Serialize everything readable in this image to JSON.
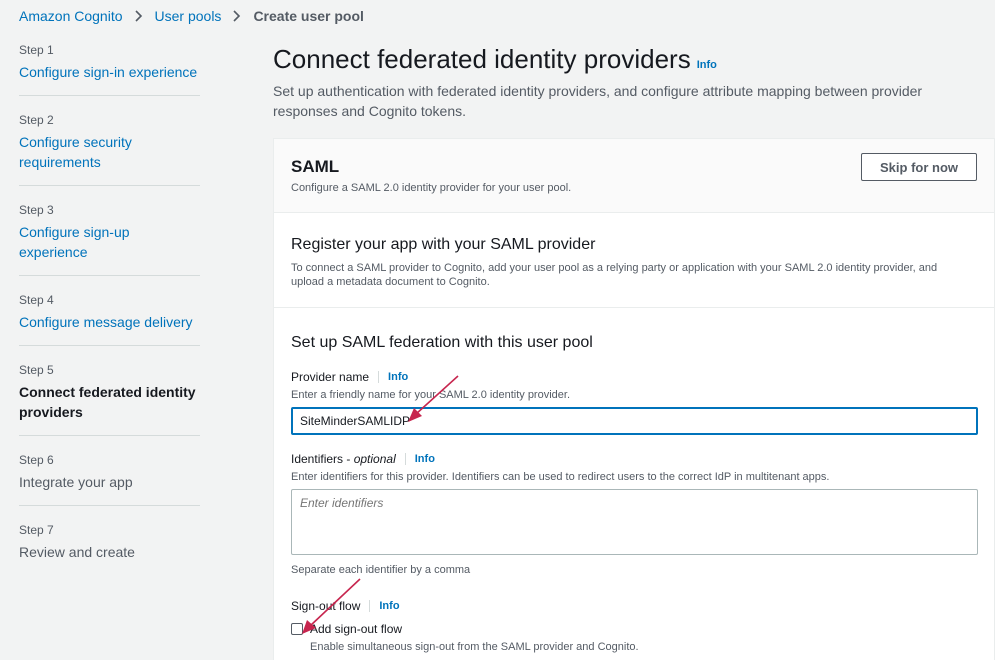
{
  "breadcrumb": {
    "item1": "Amazon Cognito",
    "item2": "User pools",
    "current": "Create user pool"
  },
  "steps": [
    {
      "num": "Step 1",
      "label": "Configure sign-in experience",
      "state": "link"
    },
    {
      "num": "Step 2",
      "label": "Configure security requirements",
      "state": "link"
    },
    {
      "num": "Step 3",
      "label": "Configure sign-up experience",
      "state": "link"
    },
    {
      "num": "Step 4",
      "label": "Configure message delivery",
      "state": "link"
    },
    {
      "num": "Step 5",
      "label": "Connect federated identity providers",
      "state": "active"
    },
    {
      "num": "Step 6",
      "label": "Integrate your app",
      "state": "disabled"
    },
    {
      "num": "Step 7",
      "label": "Review and create",
      "state": "disabled"
    }
  ],
  "page": {
    "title": "Connect federated identity providers",
    "info": "Info",
    "description": "Set up authentication with federated identity providers, and configure attribute mapping between provider responses and Cognito tokens."
  },
  "saml": {
    "title": "SAML",
    "description": "Configure a SAML 2.0 identity provider for your user pool.",
    "skip_label": "Skip for now"
  },
  "register": {
    "title": "Register your app with your SAML provider",
    "description": "To connect a SAML provider to Cognito, add your user pool as a relying party or application with your SAML 2.0 identity provider, and upload a metadata document to Cognito."
  },
  "federation": {
    "title": "Set up SAML federation with this user pool",
    "provider_name": {
      "label": "Provider name",
      "info": "Info",
      "description": "Enter a friendly name for your SAML 2.0 identity provider.",
      "value": "SiteMinderSAMLIDP"
    },
    "identifiers": {
      "label": "Identifiers -",
      "optional": "optional",
      "info": "Info",
      "description": "Enter identifiers for this provider. Identifiers can be used to redirect users to the correct IdP in multitenant apps.",
      "placeholder": "Enter identifiers",
      "hint": "Separate each identifier by a comma"
    },
    "signout": {
      "label": "Sign-out flow",
      "info": "Info",
      "checkbox_label": "Add sign-out flow",
      "checkbox_desc": "Enable simultaneous sign-out from the SAML provider and Cognito.",
      "checked": false
    }
  },
  "colors": {
    "link": "#0073bb",
    "arrow": "#c7254e",
    "background": "#f2f3f3"
  }
}
